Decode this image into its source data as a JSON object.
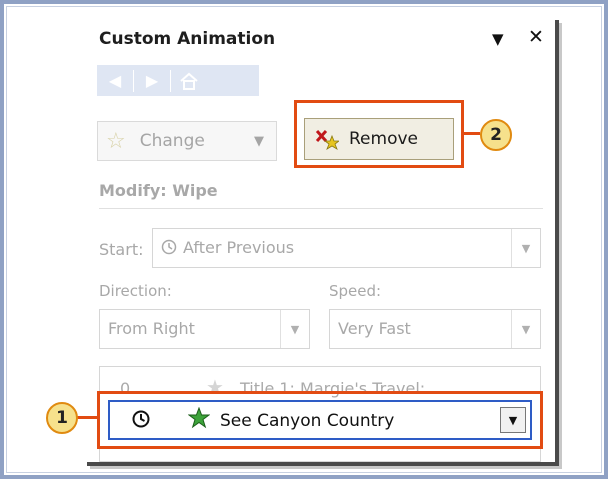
{
  "pane": {
    "title": "Custom Animation",
    "dropdown_icon": "triangle-down",
    "close_icon": "close-x"
  },
  "nav": {
    "back_icon": "arrow-left",
    "forward_icon": "arrow-right",
    "home_icon": "home"
  },
  "buttons": {
    "change_label": "Change",
    "change_icon": "effect-star",
    "remove_label": "Remove",
    "remove_icon": "remove-effect"
  },
  "modify": {
    "heading": "Modify: Wipe",
    "start_label": "Start:",
    "start_value": "After Previous",
    "direction_label": "Direction:",
    "direction_value": "From Right",
    "speed_label": "Speed:",
    "speed_value": "Very Fast"
  },
  "effects_list": [
    {
      "number": "0",
      "text": "Title 1: Margie's Travel:...",
      "state": "disabled"
    },
    {
      "number": "",
      "text": "See Canyon Country",
      "state": "selected",
      "trigger_icon": "clock"
    }
  ],
  "callouts": {
    "one": "1",
    "two": "2"
  },
  "colors": {
    "highlight": "#e24b12",
    "callout_fill": "#f6e18c",
    "selection_border": "#2e5cc6",
    "frame": "#8fa1c4",
    "disabled_text": "#a8a8a8"
  }
}
